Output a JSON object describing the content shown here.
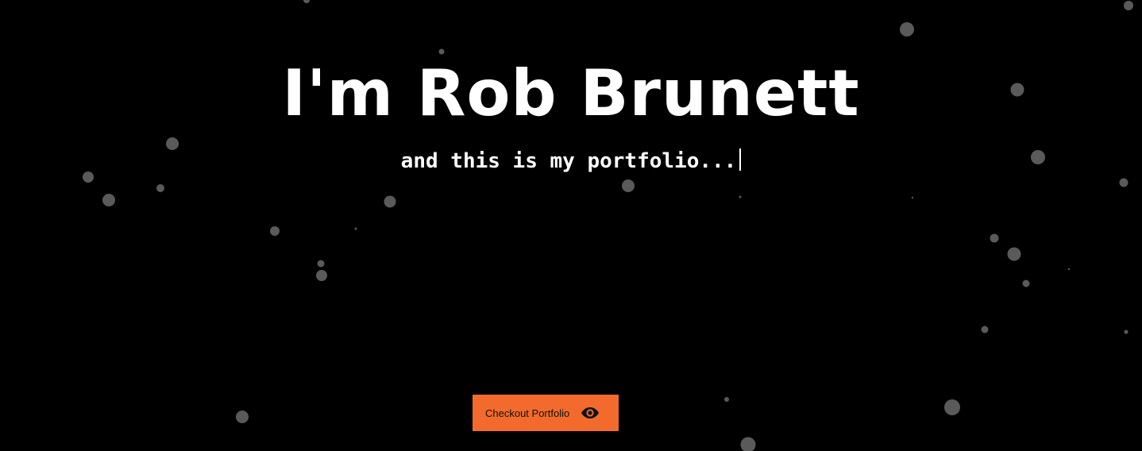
{
  "hero": {
    "title": "I'm Rob Brunett",
    "tagline": "and this is my portfolio..."
  },
  "cta": {
    "label": "Checkout Portfolio",
    "icon": "eye-icon"
  },
  "colors": {
    "background": "#000000",
    "text": "#ffffff",
    "accent": "#f26b2c",
    "particle": "#5a5a5a"
  }
}
